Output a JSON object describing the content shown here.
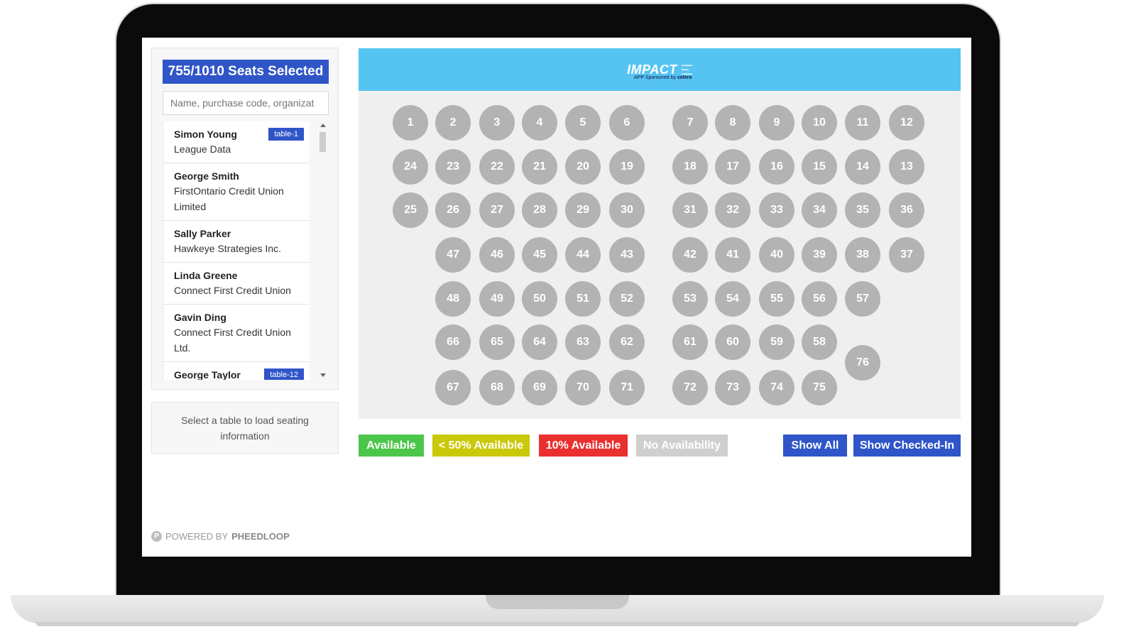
{
  "header": {
    "seats_selected": "755/1010 Seats Selected"
  },
  "search": {
    "placeholder": "Name, purchase code, organizat"
  },
  "attendees": [
    {
      "name": "Simon Young",
      "org": "League Data",
      "table": "table-1"
    },
    {
      "name": "George Smith",
      "org": "FirstOntario Credit Union Limited",
      "table": ""
    },
    {
      "name": "Sally Parker",
      "org": "Hawkeye Strategies Inc.",
      "table": ""
    },
    {
      "name": "Linda Greene",
      "org": "Connect First Credit Union",
      "table": ""
    },
    {
      "name": "Gavin Ding",
      "org": "Connect First Credit Union Ltd.",
      "table": ""
    },
    {
      "name": "George Taylor",
      "org": "",
      "table": "table-12"
    }
  ],
  "info": {
    "message": "Select a table to load seating information"
  },
  "banner": {
    "brand": "IMPACT",
    "sponsor_prefix": "APP Sponsored by",
    "sponsor": "celero"
  },
  "tables": [
    {
      "n": "1",
      "row": 0,
      "col": 0
    },
    {
      "n": "2",
      "row": 0,
      "col": 1
    },
    {
      "n": "3",
      "row": 0,
      "col": 2
    },
    {
      "n": "4",
      "row": 0,
      "col": 3
    },
    {
      "n": "5",
      "row": 0,
      "col": 4
    },
    {
      "n": "6",
      "row": 0,
      "col": 5
    },
    {
      "n": "7",
      "row": 0,
      "col": 6
    },
    {
      "n": "8",
      "row": 0,
      "col": 7
    },
    {
      "n": "9",
      "row": 0,
      "col": 8
    },
    {
      "n": "10",
      "row": 0,
      "col": 9
    },
    {
      "n": "11",
      "row": 0,
      "col": 10
    },
    {
      "n": "12",
      "row": 0,
      "col": 11
    },
    {
      "n": "24",
      "row": 1,
      "col": 0
    },
    {
      "n": "23",
      "row": 1,
      "col": 1
    },
    {
      "n": "22",
      "row": 1,
      "col": 2
    },
    {
      "n": "21",
      "row": 1,
      "col": 3
    },
    {
      "n": "20",
      "row": 1,
      "col": 4
    },
    {
      "n": "19",
      "row": 1,
      "col": 5
    },
    {
      "n": "18",
      "row": 1,
      "col": 6
    },
    {
      "n": "17",
      "row": 1,
      "col": 7
    },
    {
      "n": "16",
      "row": 1,
      "col": 8
    },
    {
      "n": "15",
      "row": 1,
      "col": 9
    },
    {
      "n": "14",
      "row": 1,
      "col": 10
    },
    {
      "n": "13",
      "row": 1,
      "col": 11
    },
    {
      "n": "25",
      "row": 2,
      "col": 0
    },
    {
      "n": "26",
      "row": 2,
      "col": 1
    },
    {
      "n": "27",
      "row": 2,
      "col": 2
    },
    {
      "n": "28",
      "row": 2,
      "col": 3
    },
    {
      "n": "29",
      "row": 2,
      "col": 4
    },
    {
      "n": "30",
      "row": 2,
      "col": 5
    },
    {
      "n": "31",
      "row": 2,
      "col": 6
    },
    {
      "n": "32",
      "row": 2,
      "col": 7
    },
    {
      "n": "33",
      "row": 2,
      "col": 8
    },
    {
      "n": "34",
      "row": 2,
      "col": 9
    },
    {
      "n": "35",
      "row": 2,
      "col": 10
    },
    {
      "n": "36",
      "row": 2,
      "col": 11
    },
    {
      "n": "47",
      "row": 3,
      "col": 1
    },
    {
      "n": "46",
      "row": 3,
      "col": 2
    },
    {
      "n": "45",
      "row": 3,
      "col": 3
    },
    {
      "n": "44",
      "row": 3,
      "col": 4
    },
    {
      "n": "43",
      "row": 3,
      "col": 5
    },
    {
      "n": "42",
      "row": 3,
      "col": 6
    },
    {
      "n": "41",
      "row": 3,
      "col": 7
    },
    {
      "n": "40",
      "row": 3,
      "col": 8
    },
    {
      "n": "39",
      "row": 3,
      "col": 9
    },
    {
      "n": "38",
      "row": 3,
      "col": 10
    },
    {
      "n": "37",
      "row": 3,
      "col": 11
    },
    {
      "n": "48",
      "row": 4,
      "col": 1
    },
    {
      "n": "49",
      "row": 4,
      "col": 2
    },
    {
      "n": "50",
      "row": 4,
      "col": 3
    },
    {
      "n": "51",
      "row": 4,
      "col": 4
    },
    {
      "n": "52",
      "row": 4,
      "col": 5
    },
    {
      "n": "53",
      "row": 4,
      "col": 6
    },
    {
      "n": "54",
      "row": 4,
      "col": 7
    },
    {
      "n": "55",
      "row": 4,
      "col": 8
    },
    {
      "n": "56",
      "row": 4,
      "col": 9
    },
    {
      "n": "57",
      "row": 4,
      "col": 10
    },
    {
      "n": "66",
      "row": 5,
      "col": 1
    },
    {
      "n": "65",
      "row": 5,
      "col": 2
    },
    {
      "n": "64",
      "row": 5,
      "col": 3
    },
    {
      "n": "63",
      "row": 5,
      "col": 4
    },
    {
      "n": "62",
      "row": 5,
      "col": 5
    },
    {
      "n": "61",
      "row": 5,
      "col": 6
    },
    {
      "n": "60",
      "row": 5,
      "col": 7
    },
    {
      "n": "59",
      "row": 5,
      "col": 8
    },
    {
      "n": "58",
      "row": 5,
      "col": 9
    },
    {
      "n": "76",
      "row": 5.45,
      "col": 10
    },
    {
      "n": "67",
      "row": 6,
      "col": 1
    },
    {
      "n": "68",
      "row": 6,
      "col": 2
    },
    {
      "n": "69",
      "row": 6,
      "col": 3
    },
    {
      "n": "70",
      "row": 6,
      "col": 4
    },
    {
      "n": "71",
      "row": 6,
      "col": 5
    },
    {
      "n": "72",
      "row": 6,
      "col": 6
    },
    {
      "n": "73",
      "row": 6,
      "col": 7
    },
    {
      "n": "74",
      "row": 6,
      "col": 8
    },
    {
      "n": "75",
      "row": 6,
      "col": 9
    }
  ],
  "legend": {
    "available": "Available",
    "under_50": "< 50% Available",
    "ten_percent": "10% Available",
    "none": "No Availability"
  },
  "legend_colors": {
    "available": "#4cc64a",
    "under_50": "#c9c90a",
    "ten_percent": "#ea2f2f",
    "none": "#cfcfcf"
  },
  "buttons": {
    "show_all": "Show All",
    "show_checked_in": "Show Checked-In"
  },
  "footer": {
    "powered_prefix": "POWERED BY",
    "powered_brand": "PHEEDLOOP"
  },
  "colors": {
    "accent": "#2f55c8",
    "banner": "#56c4f2",
    "table": "#b3b3b3"
  }
}
